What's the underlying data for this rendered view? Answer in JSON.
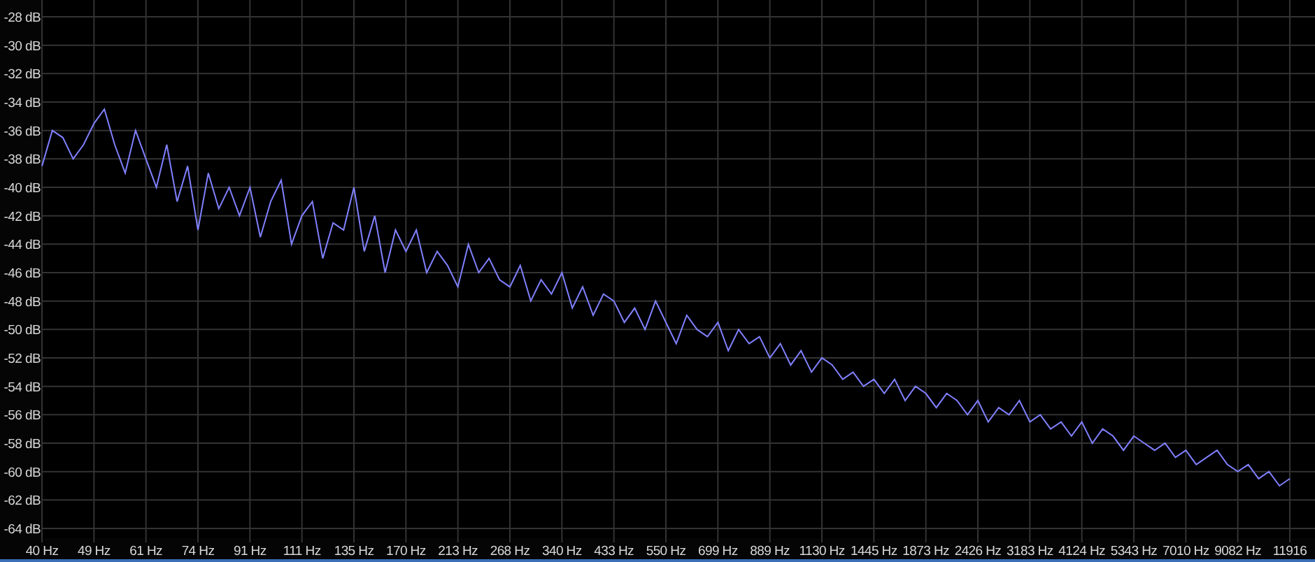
{
  "spectrum": {
    "chart_data": {
      "type": "line",
      "categories": [
        "40 Hz",
        null,
        null,
        null,
        null,
        "49 Hz",
        null,
        null,
        null,
        null,
        "61 Hz",
        null,
        null,
        null,
        null,
        "74 Hz",
        null,
        null,
        null,
        null,
        "91 Hz",
        null,
        null,
        null,
        null,
        "111 Hz",
        null,
        null,
        null,
        null,
        "135 Hz",
        null,
        null,
        null,
        null,
        "170 Hz",
        null,
        null,
        null,
        null,
        "213 Hz",
        null,
        null,
        null,
        null,
        "268 Hz",
        null,
        null,
        null,
        null,
        "340 Hz",
        null,
        null,
        null,
        null,
        "433 Hz",
        null,
        null,
        null,
        null,
        "550 Hz",
        null,
        null,
        null,
        null,
        "699 Hz",
        null,
        null,
        null,
        null,
        "889 Hz",
        null,
        null,
        null,
        null,
        "1130 Hz",
        null,
        null,
        null,
        null,
        "1445 Hz",
        null,
        null,
        null,
        null,
        "1873 Hz",
        null,
        null,
        null,
        null,
        "2426 Hz",
        null,
        null,
        null,
        null,
        "3183 Hz",
        null,
        null,
        null,
        null,
        "4124 Hz",
        null,
        null,
        null,
        null,
        "5343 Hz",
        null,
        null,
        null,
        null,
        "7010 Hz",
        null,
        null,
        null,
        null,
        "9082 Hz",
        null,
        null,
        null,
        null,
        "11916"
      ],
      "series": [
        {
          "color": "#8080ff",
          "values": [
            -38.5,
            -36,
            -36.5,
            -38,
            -37,
            -35.5,
            -34.5,
            -37,
            -39,
            -36,
            -38,
            -40,
            -37,
            -41,
            -38.5,
            -43,
            -39,
            -41.5,
            -40,
            -42,
            -40,
            -43.5,
            -41,
            -39.5,
            -44,
            -42,
            -41,
            -45,
            -42.5,
            -43,
            -40,
            -44.5,
            -42,
            -46,
            -43,
            -44.5,
            -43,
            -46,
            -44.5,
            -45.5,
            -47,
            -44,
            -46,
            -45,
            -46.5,
            -47,
            -45.5,
            -48,
            -46.5,
            -47.5,
            -46,
            -48.5,
            -47,
            -49,
            -47.5,
            -48,
            -49.5,
            -48.5,
            -50,
            -48,
            -49.5,
            -51,
            -49,
            -50,
            -50.5,
            -49.5,
            -51.5,
            -50,
            -51,
            -50.5,
            -52,
            -51,
            -52.5,
            -51.5,
            -53,
            -52,
            -52.5,
            -53.5,
            -53,
            -54,
            -53.5,
            -54.5,
            -53.5,
            -55,
            -54,
            -54.5,
            -55.5,
            -54.5,
            -55,
            -56,
            -55,
            -56.5,
            -55.5,
            -56,
            -55,
            -56.5,
            -56,
            -57,
            -56.5,
            -57.5,
            -56.5,
            -58,
            -57,
            -57.5,
            -58.5,
            -57.5,
            -58,
            -58.5,
            -58,
            -59,
            -58.5,
            -59.5,
            -59,
            -58.5,
            -59.5,
            -60,
            -59.5,
            -60.5,
            -60,
            -61,
            -60.5
          ]
        }
      ],
      "grid": true,
      "ylim": [
        -64,
        -28
      ],
      "yticks": [
        {
          "value": -28,
          "label": "-28 dB"
        },
        {
          "value": -30,
          "label": "-30 dB"
        },
        {
          "value": -32,
          "label": "-32 dB"
        },
        {
          "value": -34,
          "label": "-34 dB"
        },
        {
          "value": -36,
          "label": "-36 dB"
        },
        {
          "value": -38,
          "label": "-38 dB"
        },
        {
          "value": -40,
          "label": "-40 dB"
        },
        {
          "value": -42,
          "label": "-42 dB"
        },
        {
          "value": -44,
          "label": "-44 dB"
        },
        {
          "value": -46,
          "label": "-46 dB"
        },
        {
          "value": -48,
          "label": "-48 dB"
        },
        {
          "value": -50,
          "label": "-50 dB"
        },
        {
          "value": -52,
          "label": "-52 dB"
        },
        {
          "value": -54,
          "label": "-54 dB"
        },
        {
          "value": -56,
          "label": "-56 dB"
        },
        {
          "value": -58,
          "label": "-58 dB"
        },
        {
          "value": -60,
          "label": "-60 dB"
        },
        {
          "value": -62,
          "label": "-62 dB"
        },
        {
          "value": -64,
          "label": "-64 dB"
        }
      ]
    }
  }
}
